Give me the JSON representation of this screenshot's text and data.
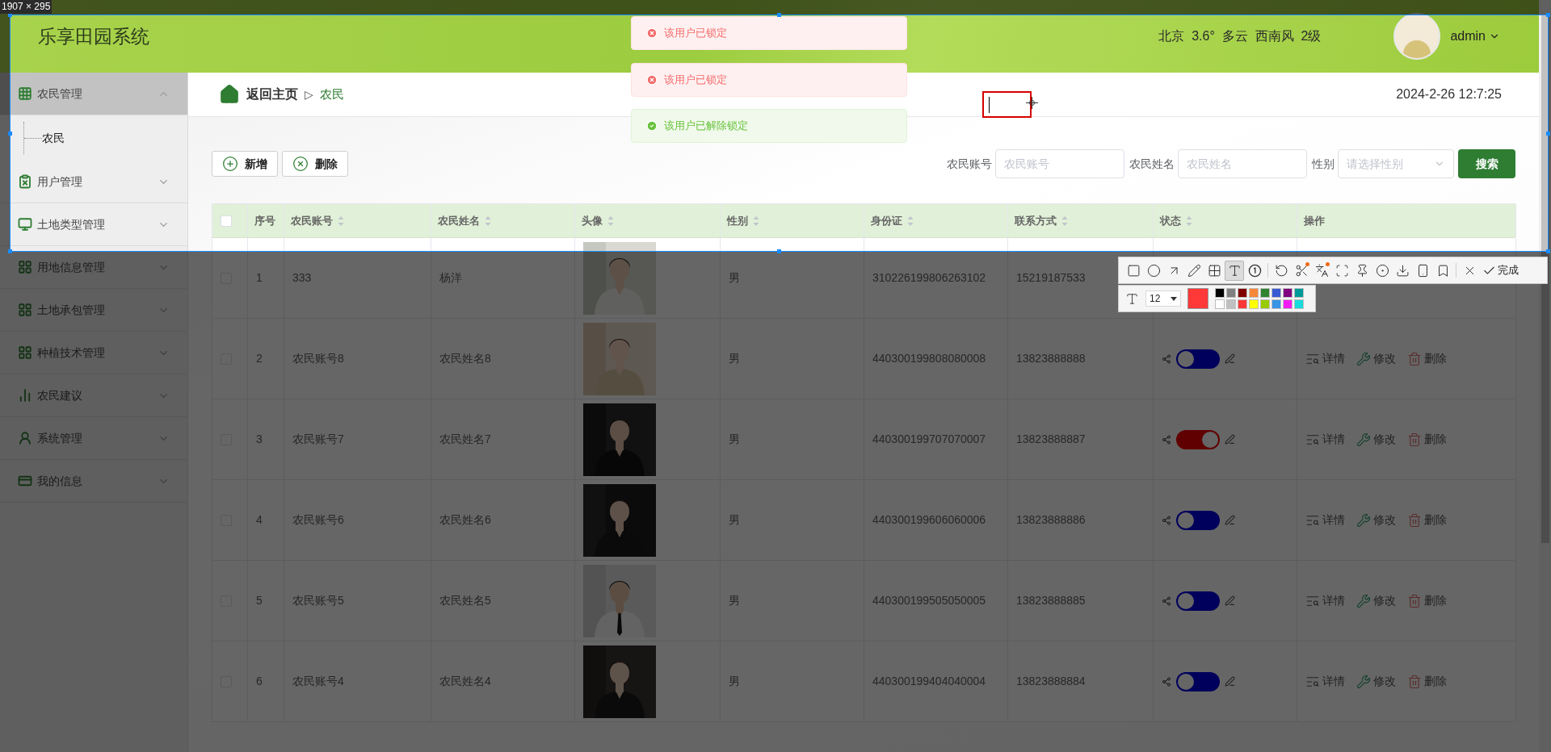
{
  "capture": {
    "size_label": "1907 × 295",
    "tool_groups": [
      [
        {
          "kind": "rectangle",
          "selected": false
        },
        {
          "kind": "ellipse",
          "selected": false
        },
        {
          "kind": "arrow",
          "selected": false
        },
        {
          "kind": "pen",
          "selected": false
        },
        {
          "kind": "mosaic",
          "selected": false
        },
        {
          "kind": "text",
          "selected": true
        },
        {
          "kind": "number",
          "selected": false
        }
      ],
      [
        {
          "kind": "undo",
          "selected": false
        },
        {
          "kind": "cut",
          "selected": false,
          "badge": true
        },
        {
          "kind": "translate",
          "selected": false,
          "badge": true
        },
        {
          "kind": "scan",
          "selected": false
        },
        {
          "kind": "pin",
          "selected": false
        },
        {
          "kind": "record",
          "selected": false
        },
        {
          "kind": "save",
          "selected": false
        },
        {
          "kind": "phone",
          "selected": false
        },
        {
          "kind": "bookmark",
          "selected": false
        }
      ]
    ],
    "done_label": "完成",
    "font_size": "12",
    "current": {
      "color": "#ff3838"
    },
    "palette": [
      {
        "color": "#000000"
      },
      {
        "color": "#808080"
      },
      {
        "color": "#800000"
      },
      {
        "color": "#f7883a"
      },
      {
        "color": "#308430"
      },
      {
        "color": "#385ad3"
      },
      {
        "color": "#800080"
      },
      {
        "color": "#009999"
      },
      {
        "color": "#ffffff"
      },
      {
        "color": "#c0c0c0"
      },
      {
        "color": "#fb3838"
      },
      {
        "color": "#ffff00"
      },
      {
        "color": "#99cc00"
      },
      {
        "color": "#3894e4"
      },
      {
        "color": "#f31bf3"
      },
      {
        "color": "#16dcdc"
      }
    ]
  },
  "header": {
    "title": "乐享田园系统",
    "weather": "北京  3.6°  多云  西南风  2级",
    "user": "admin"
  },
  "toasts": [
    {
      "kind": "error",
      "text": "该用户已锁定"
    },
    {
      "kind": "error",
      "text": "该用户已锁定"
    },
    {
      "kind": "success",
      "text": "该用户已解除锁定"
    }
  ],
  "sidebar": {
    "items": [
      {
        "label": "农民管理",
        "selected": true,
        "expanded": true,
        "children": [
          {
            "label": "农民"
          }
        ]
      },
      {
        "label": "用户管理",
        "selected": false,
        "expanded": false
      },
      {
        "label": "土地类型管理",
        "selected": false,
        "expanded": false
      },
      {
        "label": "用地信息管理",
        "selected": false,
        "expanded": false
      },
      {
        "label": "土地承包管理",
        "selected": false,
        "expanded": false
      },
      {
        "label": "种植技术管理",
        "selected": false,
        "expanded": false
      },
      {
        "label": "农民建议",
        "selected": false,
        "expanded": false
      },
      {
        "label": "系统管理",
        "selected": false,
        "expanded": false
      },
      {
        "label": "我的信息",
        "selected": false,
        "expanded": false
      }
    ]
  },
  "breadcrumb": {
    "home": "返回主页",
    "separator": "▷",
    "current": "农民"
  },
  "datetime": "2024-2-26 12:7:25",
  "toolbar": [
    {
      "kind": "add",
      "label": "新增"
    },
    {
      "kind": "delete",
      "label": "删除"
    }
  ],
  "search": {
    "fields": [
      {
        "kind": "input",
        "label": "农民账号",
        "placeholder": "农民账号"
      },
      {
        "kind": "input",
        "label": "农民姓名",
        "placeholder": "农民姓名"
      },
      {
        "kind": "select",
        "label": "性别",
        "placeholder": "请选择性别"
      }
    ],
    "button": "搜索"
  },
  "table": {
    "select_all": {
      "checked": false
    },
    "columns": [
      {
        "label": "序号",
        "sortable": false
      },
      {
        "label": "农民账号",
        "sortable": true
      },
      {
        "label": "农民姓名",
        "sortable": true
      },
      {
        "label": "头像",
        "sortable": true
      },
      {
        "label": "性别",
        "sortable": true
      },
      {
        "label": "身份证",
        "sortable": true
      },
      {
        "label": "联系方式",
        "sortable": true
      },
      {
        "label": "状态",
        "sortable": true
      },
      {
        "label": "操作",
        "sortable": false
      }
    ],
    "rows": [
      {
        "checked": false,
        "index": "1",
        "account": "333",
        "name": "杨洋",
        "gender": "男",
        "id_card": "310226199806263102",
        "phone": "15219187533"
      },
      {
        "checked": false,
        "index": "2",
        "account": "农民账号8",
        "name": "农民姓名8",
        "gender": "男",
        "id_card": "440300199808080008",
        "phone": "13823888888",
        "status": {
          "on": false
        },
        "actions": [
          {
            "kind": "detail",
            "label": "详情"
          },
          {
            "kind": "edit",
            "label": "修改"
          },
          {
            "kind": "delete",
            "label": "删除"
          }
        ]
      },
      {
        "checked": false,
        "index": "3",
        "account": "农民账号7",
        "name": "农民姓名7",
        "gender": "男",
        "id_card": "440300199707070007",
        "phone": "13823888887",
        "status": {
          "on": true
        },
        "actions": [
          {
            "kind": "detail",
            "label": "详情"
          },
          {
            "kind": "edit",
            "label": "修改"
          },
          {
            "kind": "delete",
            "label": "删除"
          }
        ]
      },
      {
        "checked": false,
        "index": "4",
        "account": "农民账号6",
        "name": "农民姓名6",
        "gender": "男",
        "id_card": "440300199606060006",
        "phone": "13823888886",
        "status": {
          "on": false
        },
        "actions": [
          {
            "kind": "detail",
            "label": "详情"
          },
          {
            "kind": "edit",
            "label": "修改"
          },
          {
            "kind": "delete",
            "label": "删除"
          }
        ]
      },
      {
        "checked": false,
        "index": "5",
        "account": "农民账号5",
        "name": "农民姓名5",
        "gender": "男",
        "id_card": "440300199505050005",
        "phone": "13823888885",
        "status": {
          "on": false
        },
        "actions": [
          {
            "kind": "detail",
            "label": "详情"
          },
          {
            "kind": "edit",
            "label": "修改"
          },
          {
            "kind": "delete",
            "label": "删除"
          }
        ]
      },
      {
        "checked": false,
        "index": "6",
        "account": "农民账号4",
        "name": "农民姓名4",
        "gender": "男",
        "id_card": "440300199404040004",
        "phone": "13823888884",
        "status": {
          "on": false
        },
        "actions": [
          {
            "kind": "detail",
            "label": "详情"
          },
          {
            "kind": "edit",
            "label": "修改"
          },
          {
            "kind": "delete",
            "label": "删除"
          }
        ]
      }
    ]
  }
}
